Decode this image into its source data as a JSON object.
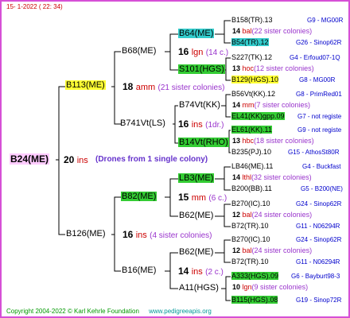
{
  "header": {
    "date": "15-  1-2022 (  22:  34)"
  },
  "footer": {
    "copyright": "Copyright 2004-2022 © Karl Kehrle Foundation",
    "site": "www.pedigreeapis.org"
  },
  "root": {
    "name": "B24(ME)",
    "gen_num": "20",
    "gen_code": "ins",
    "drones_note": "(Drones from 1 single colony)"
  },
  "dam": {
    "name": "B113(ME)",
    "gen_num": "18",
    "gen_code": "amm",
    "gen_count": "(21 sister colonies)"
  },
  "sire": {
    "name": "B126(ME)",
    "gen_num": "16",
    "gen_code": "ins",
    "gen_count": "(4 sister colonies)"
  },
  "dam_dam": {
    "name": "B68(ME)",
    "gen_num": "16",
    "gen_code": "lgn",
    "gen_count": "(14 c.)"
  },
  "dam_sire": {
    "name": "B741Vt(LS)",
    "gen_num": "16",
    "gen_code": "ins",
    "gen_count": "(1dr.)"
  },
  "sire_dam": {
    "name": "B82(ME)",
    "gen_num": "15",
    "gen_code": "mm",
    "gen_count": "(6 c.)"
  },
  "sire_sire": {
    "name": "B16(ME)",
    "gen_num": "14",
    "gen_code": "ins",
    "gen_count": "(2 c.)"
  },
  "gg": [
    {
      "name": "B64(ME)",
      "highlight": "cyan"
    },
    {
      "name": "S101(HGS)",
      "highlight": "green"
    },
    {
      "name": "B74Vt(KK)",
      "highlight": ""
    },
    {
      "name": "B14Vt(RHO)",
      "highlight": "green"
    },
    {
      "name": "LB3(ME)",
      "highlight": "green"
    },
    {
      "name": "B62(ME)",
      "highlight": ""
    },
    {
      "name": "B62(ME)",
      "highlight": ""
    },
    {
      "name": "A11(HGS)",
      "highlight": ""
    }
  ],
  "gg_gen": [
    {
      "num": "16",
      "code": "lgn",
      "count": "(14 c.)"
    },
    {
      "num": "",
      "code": "",
      "count": ""
    },
    {
      "num": "16",
      "code": "ins",
      "count": "(1dr.)"
    },
    {
      "num": "",
      "code": "",
      "count": ""
    },
    {
      "num": "15",
      "code": "mm",
      "count": "(6 c.)"
    },
    {
      "num": "",
      "code": "",
      "count": ""
    },
    {
      "num": "14",
      "code": "ins",
      "count": "(2 c.)"
    },
    {
      "num": "",
      "code": "",
      "count": ""
    }
  ],
  "leaves": [
    {
      "name": "B158(TR).13",
      "highlight": "",
      "note": "G9 - MG00R"
    },
    {
      "num": "14",
      "code": "bal",
      "count": "(22 sister colonies)"
    },
    {
      "name": "B54(TR).12",
      "highlight": "cyan",
      "note": "G26 - Sinop62R"
    },
    {
      "name": "S227(TK).12",
      "highlight": "",
      "note": "G4 - Erfoud07-1Q"
    },
    {
      "num": "13",
      "code": "hoc",
      "count": "(12 sister colonies)"
    },
    {
      "name": "B129(HGS).10",
      "highlight": "yellow",
      "note": "G8 - MG00R"
    },
    {
      "name": "B56Vt(KK).12",
      "highlight": "",
      "note": "G8 - PrimRed01"
    },
    {
      "num": "14",
      "code": "mm",
      "count": "(7 sister colonies)"
    },
    {
      "name": "EL41(KK)gpp.09",
      "highlight": "green",
      "note": "G7 - not registe"
    },
    {
      "name": "EL61(KK).11",
      "highlight": "green",
      "note": "G9 - not registe"
    },
    {
      "num": "13",
      "code": "hbc",
      "count": "(18 sister colonies)"
    },
    {
      "name": "B235(PJ).10",
      "highlight": "",
      "note": "G15 - AthosSt80R"
    },
    {
      "name": "LB46(ME).11",
      "highlight": "",
      "note": "G4 - Buckfast"
    },
    {
      "num": "14",
      "code": "lthl",
      "count": "(32 sister colonies)"
    },
    {
      "name": "B200(BB).11",
      "highlight": "",
      "note": "G5 - B200(NE)"
    },
    {
      "name": "B270(IC).10",
      "highlight": "",
      "note": "G24 - Sinop62R"
    },
    {
      "num": "12",
      "code": "bal",
      "count": "(24 sister colonies)"
    },
    {
      "name": "B72(TR).10",
      "highlight": "",
      "note": "G11 - N06294R"
    },
    {
      "name": "B270(IC).10",
      "highlight": "",
      "note": "G24 - Sinop62R"
    },
    {
      "num": "12",
      "code": "bal",
      "count": "(24 sister colonies)"
    },
    {
      "name": "B72(TR).10",
      "highlight": "",
      "note": "G11 - N06294R"
    },
    {
      "name": "A333(HGS).09",
      "highlight": "green",
      "note": "G6 - Bayburt98-3"
    },
    {
      "num": "10",
      "code": "lgn",
      "count": "(9 sister colonies)"
    },
    {
      "name": "B115(HGS).08",
      "highlight": "green",
      "note": "G19 - Sinop72R"
    }
  ]
}
